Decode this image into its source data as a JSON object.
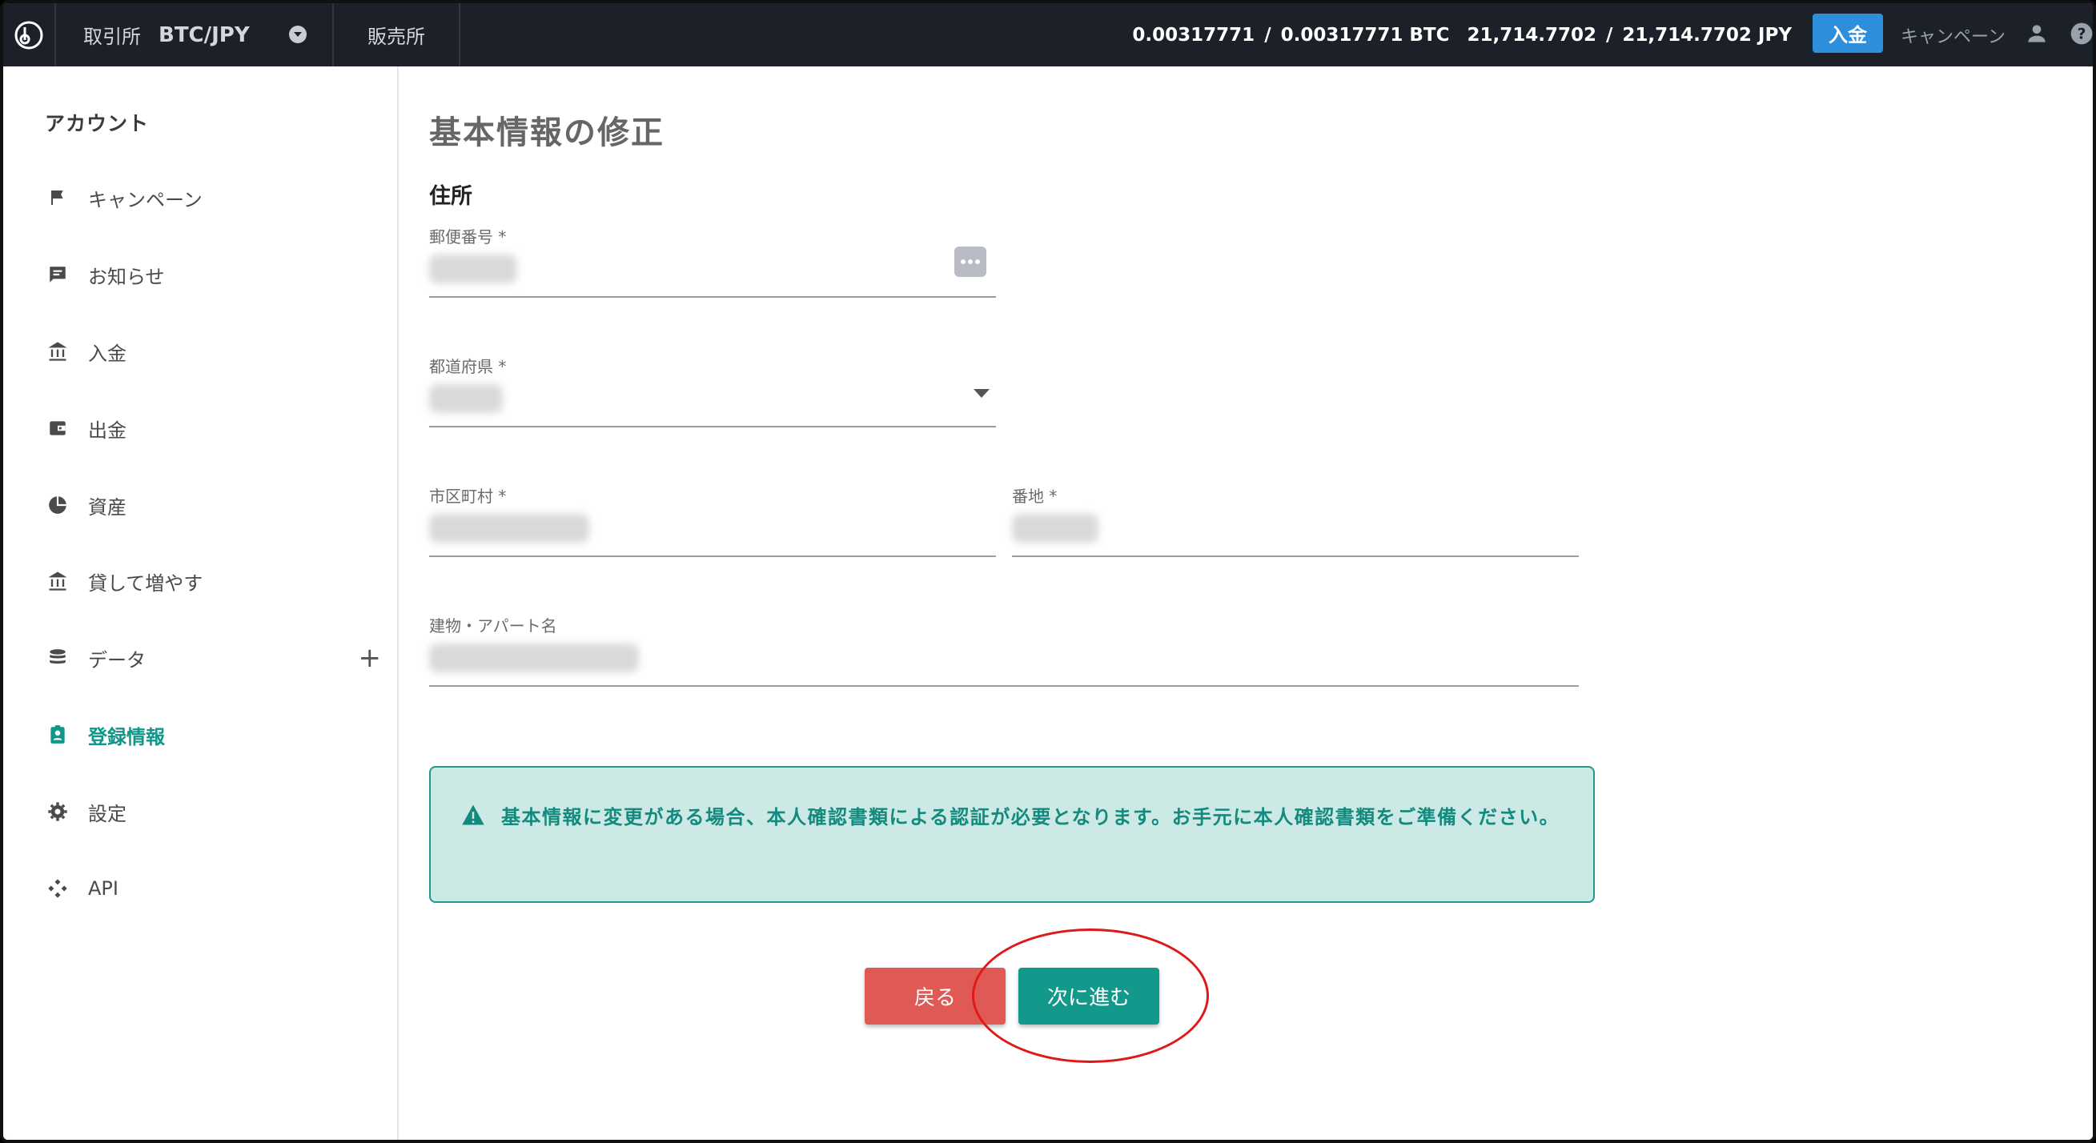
{
  "topbar": {
    "exchange_label": "取引所",
    "pair": "BTC/JPY",
    "store_label": "販売所",
    "btc_available": "0.00317771",
    "btc_total": "0.00317771",
    "btc_unit": "BTC",
    "jpy_available": "21,714.7702",
    "jpy_total": "21,714.7702",
    "jpy_unit": "JPY",
    "separator": "/",
    "deposit_label": "入金",
    "campaign_label": "キャンペーン"
  },
  "sidebar": {
    "title": "アカウント",
    "items": [
      {
        "label": "キャンペーン",
        "icon": "flag-icon"
      },
      {
        "label": "お知らせ",
        "icon": "message-icon"
      },
      {
        "label": "入金",
        "icon": "bank-icon"
      },
      {
        "label": "出金",
        "icon": "wallet-icon"
      },
      {
        "label": "資産",
        "icon": "pie-chart-icon"
      },
      {
        "label": "貸して増やす",
        "icon": "bank-icon"
      },
      {
        "label": "データ",
        "icon": "database-icon",
        "expand": "+"
      },
      {
        "label": "登録情報",
        "icon": "id-card-icon",
        "active": true
      },
      {
        "label": "設定",
        "icon": "gear-icon"
      },
      {
        "label": "API",
        "icon": "api-icon"
      }
    ]
  },
  "main": {
    "page_title": "基本情報の修正",
    "section_title": "住所",
    "fields": {
      "postal_code": {
        "label": "郵便番号 *"
      },
      "prefecture": {
        "label": "都道府県 *"
      },
      "city": {
        "label": "市区町村 *"
      },
      "street": {
        "label": "番地 *"
      },
      "building": {
        "label": "建物・アパート名"
      }
    },
    "alert_text": "基本情報に変更がある場合、本人確認書類による認証が必要となります。お手元に本人確認書類をご準備ください。",
    "back_label": "戻る",
    "next_label": "次に進む"
  },
  "colors": {
    "topbar_bg": "#1b2029",
    "accent": "#12998b",
    "back_button": "#e05a55",
    "deposit_button": "#2d8fdb",
    "alert_bg": "#cde9e6",
    "annotation": "#e01818"
  }
}
